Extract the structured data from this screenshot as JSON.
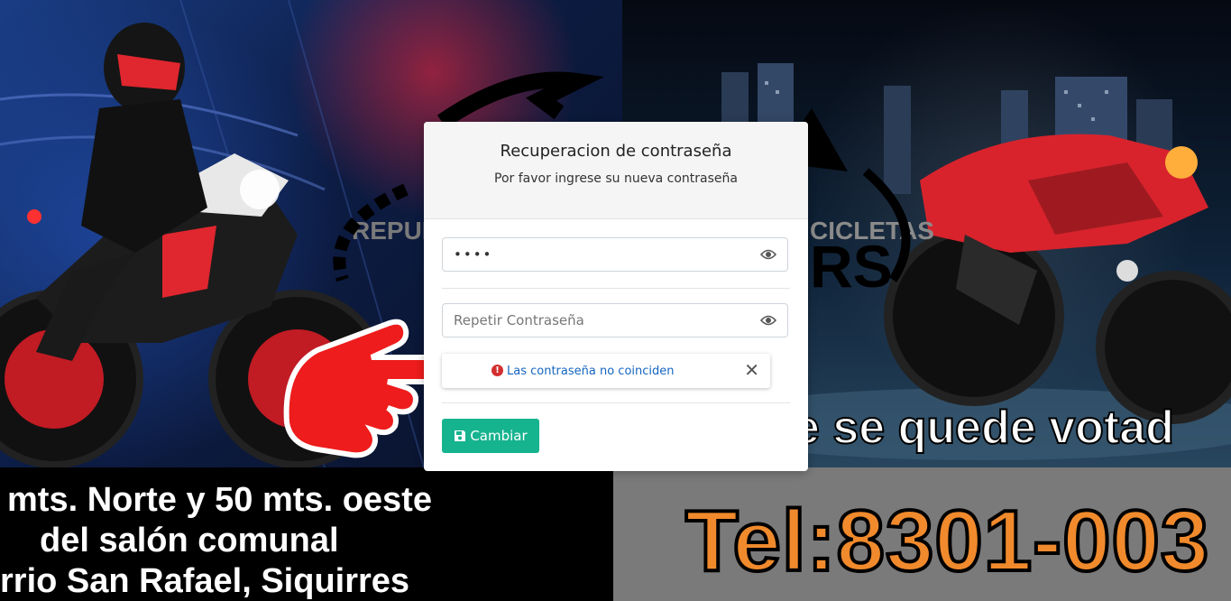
{
  "background": {
    "address_lines": [
      "mts. Norte y 50 mts. oeste",
      "del salón comunal",
      "rrio San Rafael, Siquirres"
    ],
    "phone": "Tel:8301-003",
    "slogan": "e se quede votad",
    "logo_left_text": "REPUE",
    "logo_right_text": "CICLETAS",
    "logo_big_right": "RS",
    "colors": {
      "phone_orange": "#f08a2c",
      "bike_red": "#e0262e"
    }
  },
  "modal": {
    "title": "Recuperacion de contraseña",
    "subtitle": "Por favor ingrese su nueva contraseña",
    "password": {
      "value": "••••",
      "eye_icon": "eye-icon"
    },
    "repeat_password": {
      "placeholder": "Repetir Contraseña",
      "eye_icon": "eye-icon"
    },
    "alert": {
      "message": "Las contraseña no coinciden",
      "icon": "exclamation-circle-icon",
      "close": "✕"
    },
    "submit": {
      "label": "Cambiar",
      "icon": "save-icon",
      "color": "#16b38f"
    }
  }
}
